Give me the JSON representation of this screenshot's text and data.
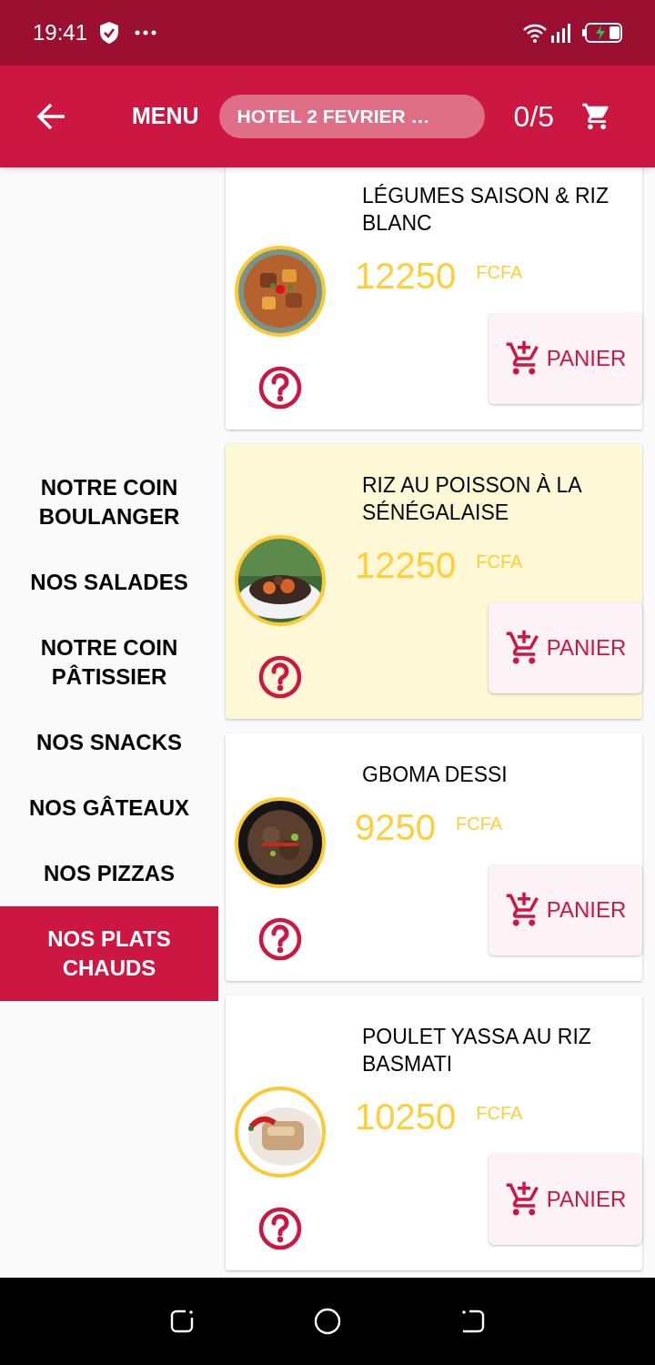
{
  "status_bar": {
    "time": "19:41"
  },
  "header": {
    "title": "MENU",
    "location": "HOTEL 2 FEVRIER …",
    "cart_count": "0/5"
  },
  "categories": [
    {
      "label": "NOTRE COIN BOULANGER",
      "selected": false
    },
    {
      "label": "NOS SALADES",
      "selected": false
    },
    {
      "label": "NOTRE COIN PÂTISSIER",
      "selected": false
    },
    {
      "label": "NOS SNACKS",
      "selected": false
    },
    {
      "label": "NOS GÂTEAUX",
      "selected": false
    },
    {
      "label": "NOS PIZZAS",
      "selected": false
    },
    {
      "label": "NOS PLATS CHAUDS",
      "selected": true
    }
  ],
  "dishes": [
    {
      "name": "LÉGUMES SAISON & RIZ BLANC",
      "price": "12250",
      "currency": "FCFA",
      "button": "PANIER",
      "highlighted": false
    },
    {
      "name": "RIZ AU POISSON À LA SÉNÉGALAISE",
      "price": "12250",
      "currency": "FCFA",
      "button": "PANIER",
      "highlighted": true
    },
    {
      "name": "GBOMA DESSI",
      "price": "9250",
      "currency": "FCFA",
      "button": "PANIER",
      "highlighted": false
    },
    {
      "name": "POULET YASSA AU RIZ BASMATI",
      "price": "10250",
      "currency": "FCFA",
      "button": "PANIER",
      "highlighted": false
    }
  ]
}
